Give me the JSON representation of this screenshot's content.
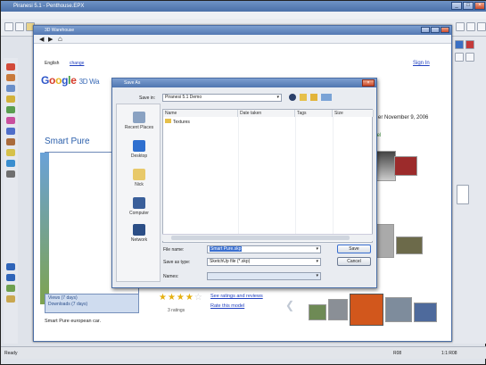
{
  "app": {
    "title": "Piranesi 5.1 - Penthouse.EPX",
    "min": "_",
    "max": "□",
    "close": "×"
  },
  "warehouse": {
    "title": "3D Warehouse",
    "language": "English",
    "change_link": "change",
    "sign_in": "Sign In",
    "logo": "Google 3D Wa",
    "model_title": "Smart Pure",
    "date_text": "er November 9, 2006",
    "model_link": "odel",
    "views_label": "Views (7 days)",
    "downloads_label": "Downloads (7 days)",
    "rating_link": "See ratings and reviews",
    "rate_link": "Rate this model",
    "ratings_count": "3 ratings",
    "description": "Smart Pure european car."
  },
  "dialog": {
    "title": "Save As",
    "save_in_label": "Save in:",
    "save_in_value": "Piranesi 5.1 Demo",
    "columns": [
      "Name",
      "Date taken",
      "Tags",
      "Size"
    ],
    "files": [
      {
        "name": "Textures",
        "type": "folder"
      }
    ],
    "places": [
      {
        "label": "Recent Places",
        "icon": "recent-places-icon"
      },
      {
        "label": "Desktop",
        "icon": "desktop-icon"
      },
      {
        "label": "Nick",
        "icon": "user-folder-icon"
      },
      {
        "label": "Computer",
        "icon": "computer-icon"
      },
      {
        "label": "Network",
        "icon": "network-icon"
      }
    ],
    "file_name_label": "File name:",
    "file_name_value": "Smart Pure.skp",
    "save_as_type_label": "Save as type:",
    "save_as_type_value": "SketchUp file (*.skp)",
    "names_label": "Names:",
    "save_button": "Save",
    "cancel_button": "Cancel"
  },
  "status": {
    "left": "Ready",
    "right1": "R08",
    "right2": "1:1:R08"
  }
}
